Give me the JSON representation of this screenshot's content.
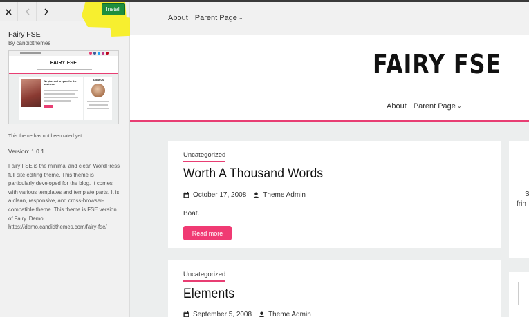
{
  "sidebar": {
    "buttons": {
      "close": "close-icon",
      "back": "chevron-left-icon",
      "forward": "chevron-right-icon"
    },
    "install_label": "Install",
    "theme_name": "Fairy FSE",
    "theme_author": "By candidthemes",
    "screenshot": {
      "site_title": "FAIRY FSE",
      "post_heading": "We plan and prepare for the business",
      "about_title": "About Us"
    },
    "rating_text": "This theme has not been rated yet.",
    "version": "Version: 1.0.1",
    "description": "Fairy FSE is the minimal and clean WordPress full site editing theme. This theme is particularly developed for the blog. It comes with various templates and template parts. It is a clean, responsive, and cross-browser-compatible theme. This theme is FSE version of Fairy. Demo: https://demo.candidthemes.com/fairy-fse/"
  },
  "preview": {
    "top_menu": {
      "about": "About",
      "parent": "Parent Page"
    },
    "site_title": "FAIRY FSE",
    "header_menu": {
      "about": "About",
      "parent": "Parent Page"
    },
    "posts": [
      {
        "category": "Uncategorized",
        "title": "Worth A Thousand Words",
        "date": "October 17, 2008",
        "author": "Theme Admin",
        "excerpt": "Boat.",
        "read_more": "Read more"
      },
      {
        "category": "Uncategorized",
        "title": "Elements",
        "date": "September 5, 2008",
        "author": "Theme Admin"
      }
    ],
    "widget_text": {
      "line1": "S",
      "line2": "frin"
    }
  },
  "colors": {
    "accent": "#e83e73",
    "install": "#1e8e3e",
    "highlight": "#f7ef1e"
  }
}
